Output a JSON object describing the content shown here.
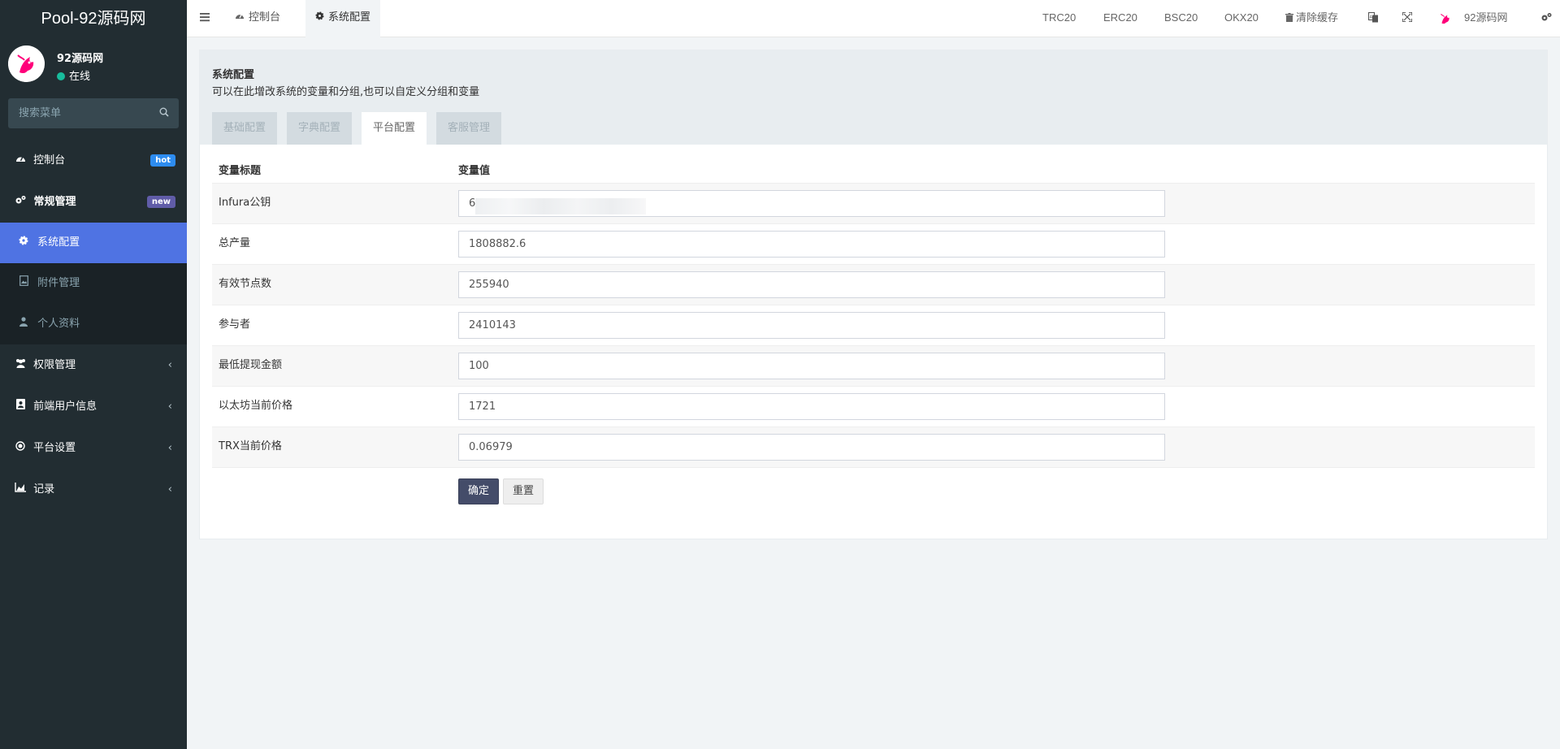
{
  "app": {
    "logo": "Pool-92源码网",
    "user_name": "92源码网",
    "user_status": "在线",
    "search_placeholder": "搜索菜单"
  },
  "sidebar": {
    "items": [
      {
        "label": "控制台",
        "icon": "dashboard-icon",
        "badge": "hot"
      },
      {
        "label": "常规管理",
        "icon": "cogs-icon",
        "badge": "new"
      },
      {
        "label": "权限管理",
        "icon": "group-icon"
      },
      {
        "label": "前端用户信息",
        "icon": "address-book-icon"
      },
      {
        "label": "平台设置",
        "icon": "circle-icon"
      },
      {
        "label": "记录",
        "icon": "area-chart-icon"
      }
    ],
    "submenu": [
      {
        "label": "系统配置",
        "icon": "gear-icon"
      },
      {
        "label": "附件管理",
        "icon": "image-file-icon"
      },
      {
        "label": "个人资料",
        "icon": "user-icon"
      }
    ]
  },
  "topbar": {
    "tabs": [
      {
        "label": "控制台"
      },
      {
        "label": "系统配置"
      }
    ],
    "links": [
      "TRC20",
      "ERC20",
      "BSC20",
      "OKX20"
    ],
    "clear_cache": "清除缓存",
    "user_name": "92源码网"
  },
  "panel": {
    "title": "系统配置",
    "subtitle": "可以在此增改系统的变量和分组,也可以自定义分组和变量",
    "tabs": [
      "基础配置",
      "字典配置",
      "平台配置",
      "客服管理"
    ],
    "active_tab": "平台配置"
  },
  "table": {
    "headers": [
      "变量标题",
      "变量值"
    ],
    "rows": [
      {
        "label": "Infura公钥",
        "value": "6"
      },
      {
        "label": "总产量",
        "value": "1808882.6"
      },
      {
        "label": "有效节点数",
        "value": "255940"
      },
      {
        "label": "参与者",
        "value": "2410143"
      },
      {
        "label": "最低提现金额",
        "value": "100"
      },
      {
        "label": "以太坊当前价格",
        "value": "1721"
      },
      {
        "label": "TRX当前价格",
        "value": "0.06979"
      }
    ]
  },
  "buttons": {
    "ok": "确定",
    "reset": "重置"
  },
  "colors": {
    "sidebar_bg": "#222d32",
    "active_menu": "#4f73e3",
    "submit_button": "#444c69"
  }
}
